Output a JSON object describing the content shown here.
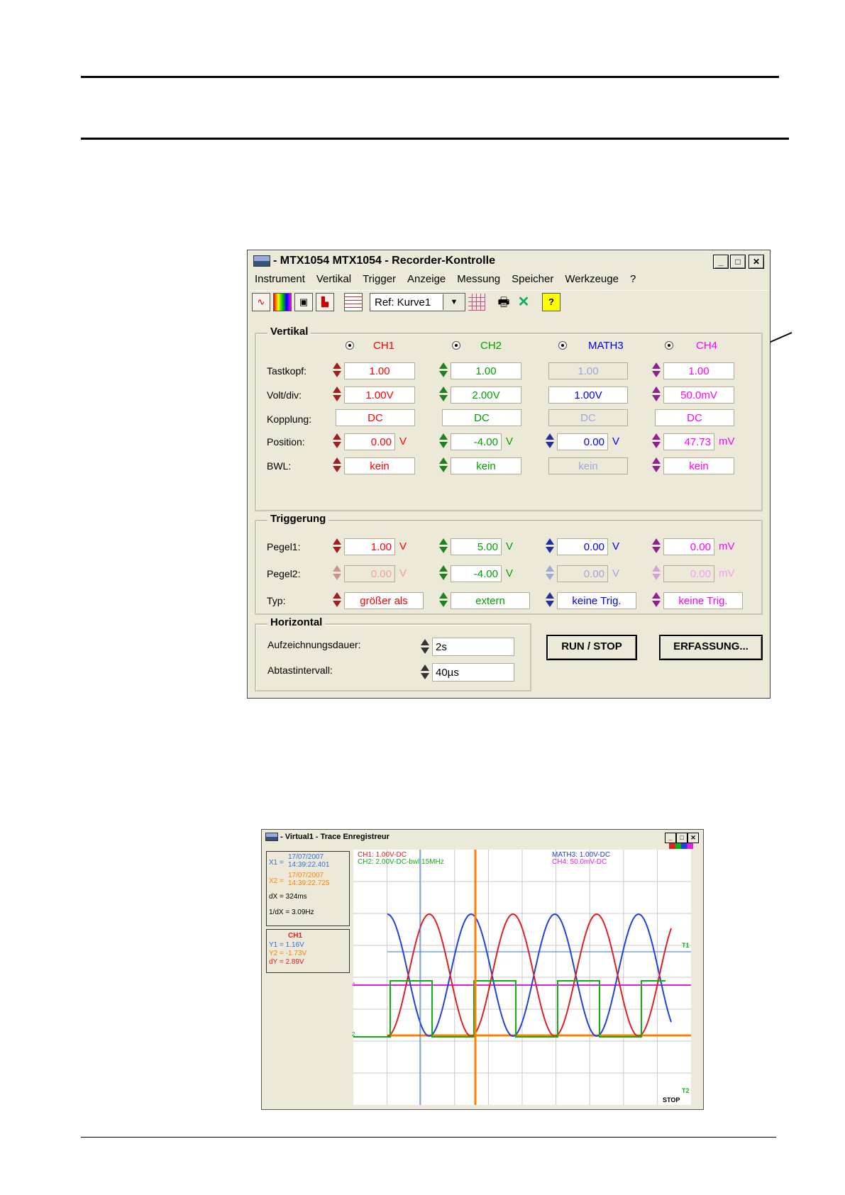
{
  "recorder": {
    "title": "- MTX1054 MTX1054 - Recorder-Kontrolle",
    "controls": {
      "minimize": "_",
      "maximize": "□",
      "close": "✕"
    },
    "menu": [
      "Instrument",
      "Vertikal",
      "Trigger",
      "Anzeige",
      "Messung",
      "Speicher",
      "Werkzeuge",
      "?"
    ],
    "toolbar": {
      "ref_value": "Ref: Kurve1",
      "help": "?"
    },
    "vertikal": {
      "legend": "Vertikal",
      "row_labels": {
        "tastkopf": "Tastkopf:",
        "volt_div": "Volt/div:",
        "kopplung": "Kopplung:",
        "position": "Position:",
        "bwl": "BWL:"
      },
      "channels": [
        {
          "name": "CH1",
          "color": "#ff0000",
          "tastkopf": "1.00",
          "volt_div": "1.00V",
          "kopplung": "DC",
          "position": "0.00",
          "position_unit": "V",
          "bwl": "kein"
        },
        {
          "name": "CH2",
          "color": "#00a000",
          "tastkopf": "1.00",
          "volt_div": "2.00V",
          "kopplung": "DC",
          "position": "-4.00",
          "position_unit": "V",
          "bwl": "kein"
        },
        {
          "name": "MATH3",
          "color": "#0000ff",
          "tastkopf": "1.00",
          "volt_div": "1.00V",
          "kopplung": "DC",
          "position": "0.00",
          "position_unit": "V",
          "bwl": "kein"
        },
        {
          "name": "CH4",
          "color": "#ff00ff",
          "tastkopf": "1.00",
          "volt_div": "50.0mV",
          "kopplung": "DC",
          "position": "47.73",
          "position_unit": "mV",
          "bwl": "kein"
        }
      ]
    },
    "triggerung": {
      "legend": "Triggerung",
      "row_labels": {
        "pegel1": "Pegel1:",
        "pegel2": "Pegel2:",
        "typ": "Typ:"
      },
      "channels": [
        {
          "pegel1": "1.00",
          "pegel1_unit": "V",
          "pegel2": "0.00",
          "pegel2_unit": "V",
          "typ": "größer als"
        },
        {
          "pegel1": "5.00",
          "pegel1_unit": "V",
          "pegel2": "-4.00",
          "pegel2_unit": "V",
          "typ": "extern"
        },
        {
          "pegel1": "0.00",
          "pegel1_unit": "V",
          "pegel2": "0.00",
          "pegel2_unit": "V",
          "typ": "keine Trig."
        },
        {
          "pegel1": "0.00",
          "pegel1_unit": "mV",
          "pegel2": "0.00",
          "pegel2_unit": "mV",
          "typ": "keine Trig."
        }
      ]
    },
    "horizontal": {
      "legend": "Horizontal",
      "aufzeichnungsdauer_label": "Aufzeichnungsdauer:",
      "aufzeichnungsdauer": "2s",
      "abtastintervall_label": "Abtastintervall:",
      "abtastintervall": "40µs"
    },
    "buttons": {
      "run_stop": "RUN / STOP",
      "erfassung": "ERFASSUNG..."
    }
  },
  "trace": {
    "title": "- Virtual1 - Trace Enregistreur",
    "cursors": {
      "x1_label": "X1 =",
      "x1_date": "17/07/2007",
      "x1_time": "14:39:22.401",
      "x2_label": "X2 =",
      "x2_date": "17/07/2007",
      "x2_time": "14:39:22.725",
      "dx": "dX = 324ms",
      "inv_dx": "1/dX = 3.09Hz"
    },
    "measure": {
      "channel": "CH1",
      "y1": "Y1 = 1.16V",
      "y2": "Y2 = -1.73V",
      "dy": "dY = 2.89V"
    },
    "scope_labels": {
      "ch1": "CH1: 1.00V-DC",
      "ch2": "CH2: 2.00V-DC-bwl 15MHz",
      "math3": "MATH3: 1.00V-DC",
      "ch4": "CH4: 50.0mV-DC",
      "status": "STOP",
      "t1": "T1",
      "t2": "T2",
      "marker_4": "4",
      "marker_2": "2"
    },
    "colors": {
      "ch1": "#e02020",
      "ch2": "#10b010",
      "math3": "#2040e0",
      "ch4": "#e020e0",
      "cursor_x1": "#3070e0",
      "cursor_x2": "#ff8000"
    }
  }
}
